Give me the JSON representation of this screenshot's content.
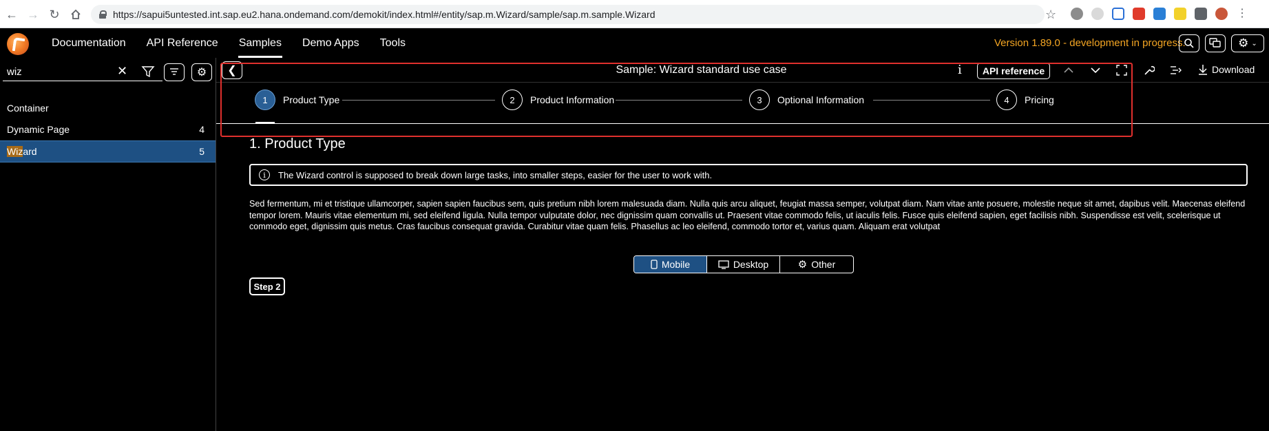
{
  "browser": {
    "url": "https://sapui5untested.int.sap.eu2.hana.ondemand.com/demokit/index.html#/entity/sap.m.Wizard/sample/sap.m.sample.Wizard"
  },
  "shell": {
    "nav": [
      "Documentation",
      "API Reference",
      "Samples",
      "Demo Apps",
      "Tools"
    ],
    "active_nav": "Samples",
    "version": "Version 1.89.0 - development in progress."
  },
  "sidebar": {
    "search": {
      "value": "wiz"
    },
    "groups": [
      {
        "label": "Container",
        "count": ""
      },
      {
        "label": "Dynamic Page",
        "count": "4"
      }
    ],
    "selected": {
      "highlight": "Wiz",
      "rest": "ard",
      "count": "5"
    }
  },
  "sample": {
    "title": "Sample: Wizard standard use case",
    "info": "i",
    "api_ref": "API reference",
    "download": "Download"
  },
  "wizard": {
    "steps": [
      {
        "num": "1",
        "label": "Product Type"
      },
      {
        "num": "2",
        "label": "Product Information"
      },
      {
        "num": "3",
        "label": "Optional Information"
      },
      {
        "num": "4",
        "label": "Pricing"
      }
    ],
    "current_title": "1. Product Type",
    "info_strip": "The Wizard control is supposed to break down large tasks, into smaller steps, easier for the user to work with.",
    "paragraph": "Sed fermentum, mi et tristique ullamcorper, sapien sapien faucibus sem, quis pretium nibh lorem malesuada diam. Nulla quis arcu aliquet, feugiat massa semper, volutpat diam. Nam vitae ante posuere, molestie neque sit amet, dapibus velit. Maecenas eleifend tempor lorem. Mauris vitae elementum mi, sed eleifend ligula. Nulla tempor vulputate dolor, nec dignissim quam convallis ut. Praesent vitae commodo felis, ut iaculis felis. Fusce quis eleifend sapien, eget facilisis nibh. Suspendisse est velit, scelerisque ut commodo eget, dignissim quis metus. Cras faucibus consequat gravida. Curabitur vitae quam felis. Phasellus ac leo eleifend, commodo tortor et, varius quam. Aliquam erat volutpat",
    "segments": [
      "Mobile",
      "Desktop",
      "Other"
    ],
    "next_step": "Step 2"
  },
  "colors": {
    "accent": "#1e5083",
    "version_text": "#f5a623",
    "frame": "#e0302d"
  }
}
